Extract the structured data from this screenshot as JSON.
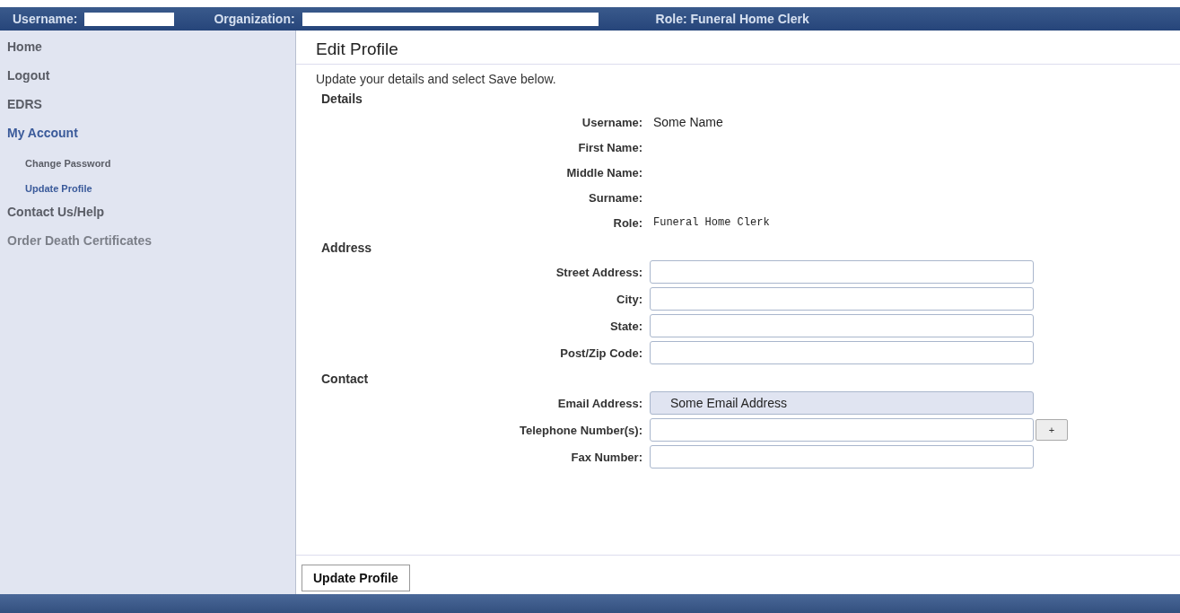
{
  "top_bar": {
    "username_label": "Username:",
    "organization_label": "Organization:",
    "role": "Role: Funeral Home Clerk"
  },
  "sidebar": {
    "items": [
      {
        "label": "Home",
        "selected": false,
        "disabled": false
      },
      {
        "label": "Logout",
        "selected": false,
        "disabled": false
      },
      {
        "label": "EDRS",
        "selected": false,
        "disabled": false
      },
      {
        "label": "My Account",
        "selected": true,
        "disabled": false,
        "children": [
          {
            "label": "Change Password",
            "selected": false,
            "disabled": false
          },
          {
            "label": "Update Profile",
            "selected": true,
            "disabled": false
          }
        ]
      },
      {
        "label": "Contact Us/Help",
        "selected": false,
        "disabled": false
      },
      {
        "label": "Order Death Certificates",
        "selected": false,
        "disabled": true
      }
    ]
  },
  "page": {
    "title": "Edit Profile",
    "intro": "Update your details and select Save below.",
    "sections": [
      {
        "heading": "Details",
        "fields": [
          {
            "kind": "text",
            "label": "Username:",
            "value": "Some Name"
          },
          {
            "kind": "text",
            "label": "First Name:"
          },
          {
            "kind": "text",
            "label": "Middle Name:"
          },
          {
            "kind": "text",
            "label": "Surname:"
          },
          {
            "kind": "mono",
            "label": "Role:",
            "value": "Funeral Home Clerk"
          }
        ]
      },
      {
        "heading": "Address",
        "fields": [
          {
            "kind": "input",
            "label": "Street Address:"
          },
          {
            "kind": "input",
            "label": "City:"
          },
          {
            "kind": "input",
            "label": "State:"
          },
          {
            "kind": "input",
            "label": "Post/Zip Code:"
          }
        ]
      },
      {
        "heading": "Contact",
        "fields": [
          {
            "kind": "readonly",
            "label": "Email Address:",
            "value": "Some Email Address"
          },
          {
            "kind": "input",
            "label": "Telephone Number(s):",
            "add_button": "+"
          },
          {
            "kind": "input",
            "label": "Fax Number:"
          }
        ]
      }
    ],
    "submit": "Update Profile"
  }
}
